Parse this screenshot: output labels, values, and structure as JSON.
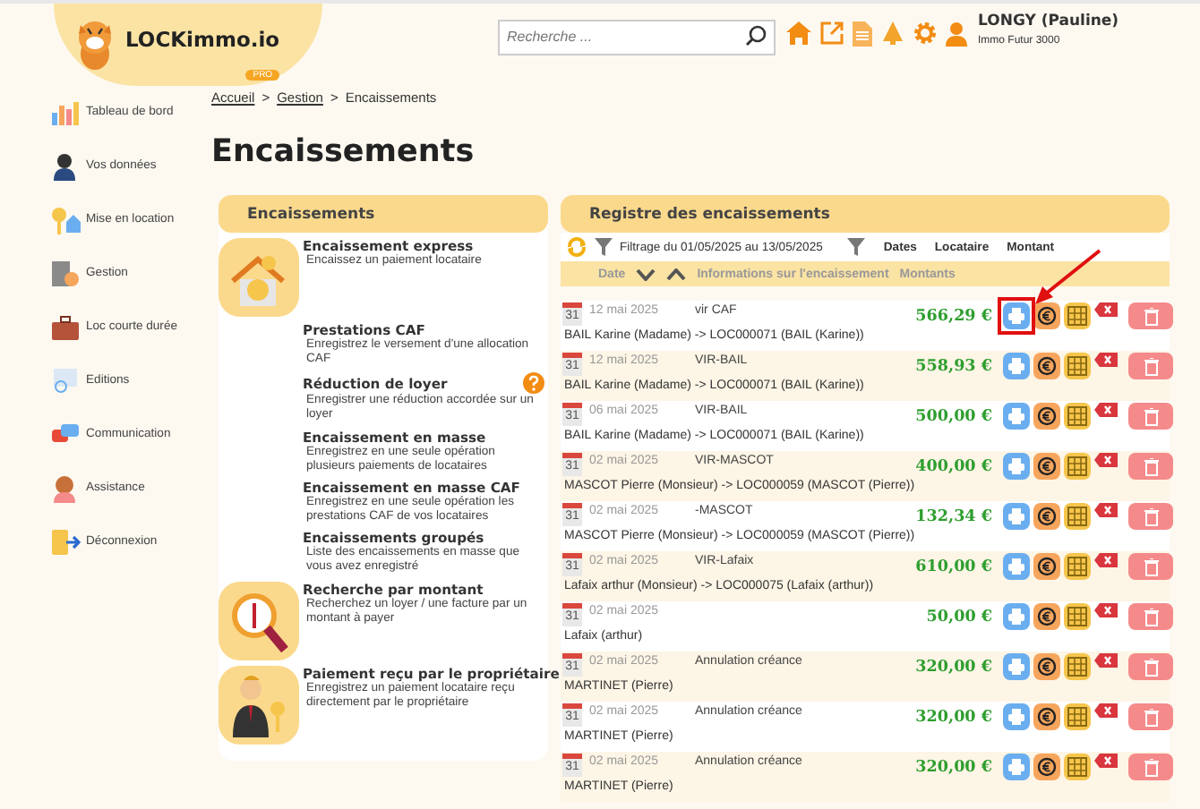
{
  "header": {
    "logo": "LOCKimmo.io",
    "logo_badge": "PRO",
    "search": {
      "placeholder": "Recherche ..."
    },
    "user": {
      "name": "LONGY (Pauline)",
      "company": "Immo Futur 3000"
    }
  },
  "sidebar": {
    "items": [
      {
        "label": "Tableau de bord"
      },
      {
        "label": "Vos données"
      },
      {
        "label": "Mise en location"
      },
      {
        "label": "Gestion"
      },
      {
        "label": "Loc courte durée"
      },
      {
        "label": "Editions"
      },
      {
        "label": "Communication"
      },
      {
        "label": "Assistance"
      },
      {
        "label": "Déconnexion"
      }
    ]
  },
  "breadcrumb": [
    {
      "label": "Accueil",
      "link": true
    },
    {
      "label": "Gestion",
      "link": true
    },
    {
      "label": "Encaissements",
      "link": false
    }
  ],
  "breadcrumb_separator": ">",
  "page_title": "Encaissements",
  "actions_panel": {
    "title": "Encaissements",
    "items": [
      {
        "title": "Encaissement express",
        "description": "Encaissez un paiement locataire",
        "illustrated": true,
        "help": false
      },
      {
        "title": "Prestations CAF",
        "description": "Enregistrez le versement d'une allocation CAF",
        "illustrated": false,
        "help": false
      },
      {
        "title": "Réduction de loyer",
        "description": "Enregistrer une réduction accordée sur un loyer",
        "illustrated": false,
        "help": true
      },
      {
        "title": "Encaissement en masse",
        "description": "Enregistrez en une seule opération plusieurs paiements de locataires",
        "illustrated": false,
        "help": false
      },
      {
        "title": "Encaissement en masse CAF",
        "description": "Enregistrez en une seule opération les prestations CAF de vos locataires",
        "illustrated": false,
        "help": false
      },
      {
        "title": "Encaissements groupés",
        "description": "Liste des encaissements en masse que vous avez enregistré",
        "illustrated": false,
        "help": false
      },
      {
        "title": "Recherche par montant",
        "description": "Recherchez un loyer / une facture par un montant à payer",
        "illustrated": true,
        "help": false
      },
      {
        "title": "Paiement reçu par le propriétaire",
        "description": "Enregistrez un paiement locataire reçu directement par le propriétaire",
        "illustrated": true,
        "help": false
      }
    ]
  },
  "register": {
    "title": "Registre des encaissements",
    "filter": {
      "label": "Filtrage du 01/05/2025 au 13/05/2025",
      "sort_options": [
        "Dates",
        "Locataire",
        "Montant"
      ]
    },
    "columns": [
      "Date",
      "Informations sur l'encaissement",
      "Montants"
    ],
    "rows": [
      {
        "day": "31",
        "date": "12 mai 2025",
        "label": "vir CAF",
        "tenant": "BAIL Karine (Madame) -> LOC000071 (BAIL (Karine))",
        "amount": "566,29 €",
        "highlighted": true
      },
      {
        "day": "31",
        "date": "12 mai 2025",
        "label": "VIR-BAIL",
        "tenant": "BAIL Karine (Madame) -> LOC000071 (BAIL (Karine))",
        "amount": "558,93 €",
        "highlighted": false
      },
      {
        "day": "31",
        "date": "06 mai 2025",
        "label": "VIR-BAIL",
        "tenant": "BAIL Karine (Madame) -> LOC000071 (BAIL (Karine))",
        "amount": "500,00 €",
        "highlighted": false
      },
      {
        "day": "31",
        "date": "02 mai 2025",
        "label": "VIR-MASCOT",
        "tenant": "MASCOT Pierre (Monsieur) -> LOC000059 (MASCOT (Pierre))",
        "amount": "400,00 €",
        "highlighted": false
      },
      {
        "day": "31",
        "date": "02 mai 2025",
        "label": "-MASCOT",
        "tenant": "MASCOT Pierre (Monsieur) -> LOC000059 (MASCOT (Pierre))",
        "amount": "132,34 €",
        "highlighted": false
      },
      {
        "day": "31",
        "date": "02 mai 2025",
        "label": "VIR-Lafaix",
        "tenant": "Lafaix arthur (Monsieur) -> LOC000075 (Lafaix (arthur))",
        "amount": "610,00 €",
        "highlighted": false
      },
      {
        "day": "31",
        "date": "02 mai 2025",
        "tenant": "Lafaix (arthur)",
        "amount": "50,00 €",
        "highlighted": false
      },
      {
        "day": "31",
        "date": "02 mai 2025",
        "label": "Annulation créance",
        "tenant": "MARTINET (Pierre)",
        "amount": "320,00 €",
        "highlighted": false
      },
      {
        "day": "31",
        "date": "02 mai 2025",
        "label": "Annulation créance",
        "tenant": "MARTINET (Pierre)",
        "amount": "320,00 €",
        "highlighted": false
      },
      {
        "day": "31",
        "date": "02 mai 2025",
        "label": "Annulation créance",
        "tenant": "MARTINET (Pierre)",
        "amount": "320,00 €",
        "highlighted": false
      }
    ]
  }
}
